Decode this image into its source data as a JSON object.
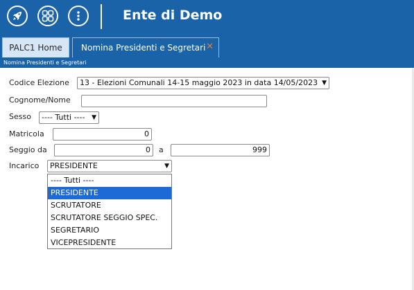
{
  "app": {
    "title": "Ente di Demo"
  },
  "tabs": [
    {
      "label": "PALC1 Home"
    },
    {
      "label": "Nomina Presidenti e Segretari"
    }
  ],
  "subheader": "Nomina Presidenti e Segretari",
  "form": {
    "codice_elezione": {
      "label": "Codice Elezione",
      "value": "13 - Elezioni Comunali 14-15 maggio 2023 in data 14/05/2023"
    },
    "cognome_nome": {
      "label": "Cognome/Nome",
      "value": ""
    },
    "sesso": {
      "label": "Sesso",
      "value": "---- Tutti ----"
    },
    "matricola": {
      "label": "Matricola",
      "value": "0"
    },
    "seggio": {
      "label": "Seggio da",
      "from": "0",
      "sep": "a",
      "to": "999"
    },
    "incarico": {
      "label": "Incarico",
      "value": "PRESIDENTE",
      "options": [
        "---- Tutti ----",
        "PRESIDENTE",
        "SCRUTATORE",
        "SCRUTATORE SEGGIO SPEC.",
        "SEGRETARIO",
        "VICEPRESIDENTE"
      ]
    }
  },
  "colors": {
    "brand": "#1a63a8",
    "close": "#f07a22",
    "selected_option": "#1d6ad6"
  },
  "icons": [
    "rocket-icon",
    "grid-icon",
    "more-vertical-icon",
    "close-icon",
    "chevron-down-icon"
  ]
}
